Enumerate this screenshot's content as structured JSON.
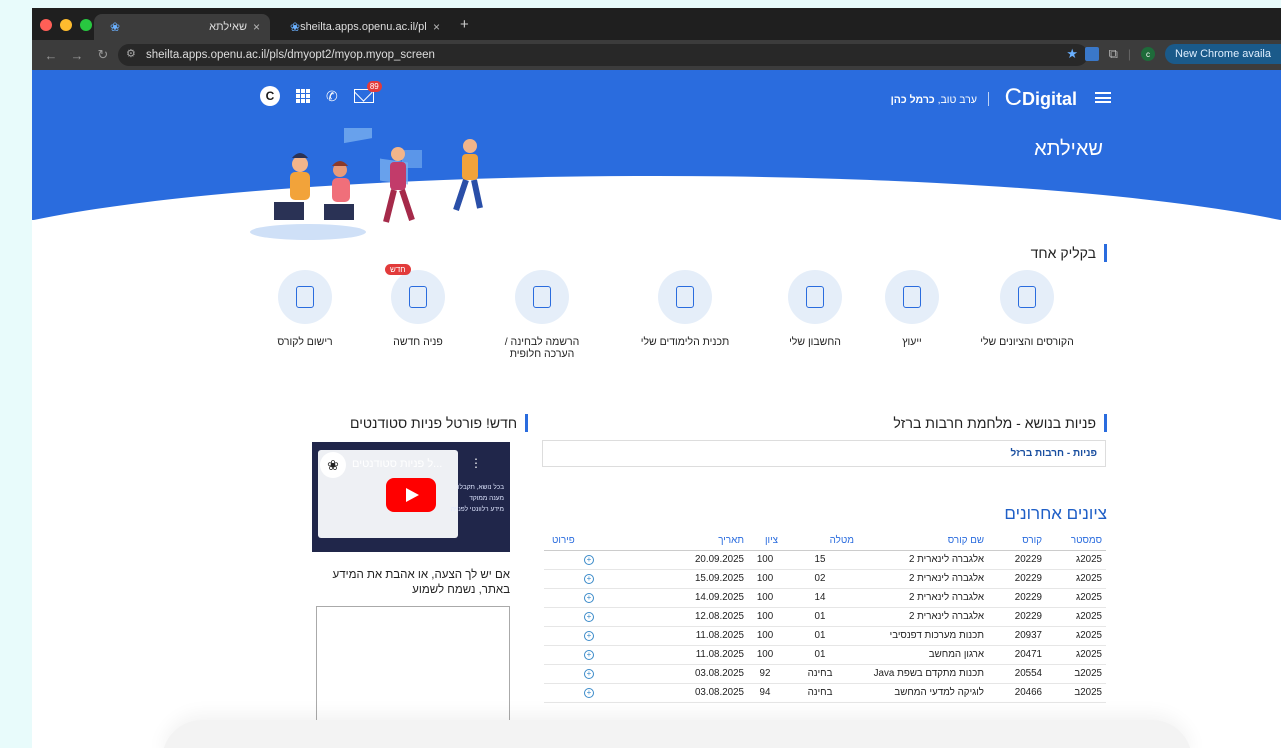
{
  "browser": {
    "tabs": [
      {
        "title": "שאילתא",
        "active": true
      },
      {
        "title": "sheilta.apps.openu.ac.il/pls/d",
        "active": false
      }
    ],
    "url": "sheilta.apps.openu.ac.il/pls/dmyopt2/myop.myop_screen",
    "update_label": "New Chrome availa",
    "profile_initial": "c"
  },
  "header": {
    "logo_text": "Digital",
    "user_greeting": "ערב טוב,",
    "user_name": "כרמל כהן",
    "page_title": "שאילתא",
    "avatar_letter": "C",
    "mail_count": "89"
  },
  "quick_links": {
    "title": "בקליק אחד",
    "items": [
      {
        "label": "הקורסים והציונים שלי",
        "icon": "courses-icon"
      },
      {
        "label": "ייעוץ",
        "icon": "advice-icon"
      },
      {
        "label": "החשבון שלי",
        "icon": "account-icon"
      },
      {
        "label": "תכנית הלימודים שלי",
        "icon": "study-plan-icon"
      },
      {
        "label": "הרשמה לבחינה / הערכה חלופית",
        "icon": "exam-registration-icon"
      },
      {
        "label": "פניה חדשה",
        "icon": "new-inquiry-icon",
        "badge": "חדש"
      },
      {
        "label": "רישום לקורס",
        "icon": "course-registration-icon"
      }
    ]
  },
  "inquiries": {
    "title": "פניות בנושא - מלחמת חרבות ברזל",
    "link": "פניות - חרבות ברזל"
  },
  "grades": {
    "title": "ציונים אחרונים",
    "columns": [
      "סמסטר",
      "קורס",
      "שם קורס",
      "מטלה",
      "ציון",
      "תאריך",
      "פירוט"
    ],
    "rows": [
      [
        "2025ג",
        "20229",
        "אלגברה לינארית 2",
        "15",
        "100",
        "20.09.2025"
      ],
      [
        "2025ג",
        "20229",
        "אלגברה לינארית 2",
        "02",
        "100",
        "15.09.2025"
      ],
      [
        "2025ג",
        "20229",
        "אלגברה לינארית 2",
        "14",
        "100",
        "14.09.2025"
      ],
      [
        "2025ג",
        "20229",
        "אלגברה לינארית 2",
        "01",
        "100",
        "12.08.2025"
      ],
      [
        "2025ג",
        "20937",
        "תכנות מערכות דפנסיבי",
        "01",
        "100",
        "11.08.2025"
      ],
      [
        "2025ג",
        "20471",
        "ארגון המחשב",
        "01",
        "100",
        "11.08.2025"
      ],
      [
        "2025ב",
        "20554",
        "תכנות מתקדם בשפת Java",
        "בחינה",
        "92",
        "03.08.2025"
      ],
      [
        "2025ב",
        "20466",
        "לוגיקה למדעי המחשב",
        "בחינה",
        "94",
        "03.08.2025"
      ]
    ]
  },
  "portal": {
    "title": "חדש! פורטל פניות סטודנטים",
    "video_title": "...ל פניות סטודנטים",
    "video_side_lines": [
      "בכל נושא, תקבלו:",
      "מענה ממוקד",
      "מידע רלוונטי לפנייה"
    ],
    "feedback_text": "אם יש לך הצעה, או אהבת את המידע באתר, נשמח לשמוע"
  },
  "colors": {
    "brand_blue": "#2a6cde",
    "link_blue": "#1f5fc7",
    "badge_red": "#e23b3b"
  }
}
